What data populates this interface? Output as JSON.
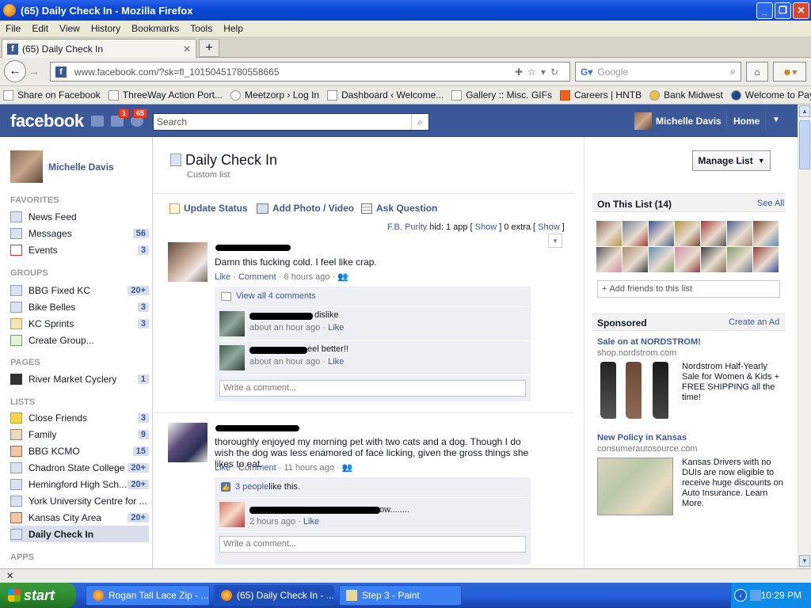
{
  "window": {
    "title": "(65) Daily Check In - Mozilla Firefox"
  },
  "menu": [
    "File",
    "Edit",
    "View",
    "History",
    "Bookmarks",
    "Tools",
    "Help"
  ],
  "tab": {
    "title": "(65) Daily Check In"
  },
  "url": "www.facebook.com/?sk=fl_10150451780558665",
  "browser_search_placeholder": "Google",
  "bookmarks": [
    "Share on Facebook",
    "ThreeWay Action Port...",
    "Meetzorp › Log In",
    "Dashboard ‹ Welcome...",
    "Gallery :: Misc. GIFs",
    "Careers | HNTB",
    "Bank Midwest",
    "Welcome to PayXpress!"
  ],
  "fb": {
    "logo": "facebook",
    "badge_messages": "1",
    "badge_notifications": "65",
    "search_placeholder": "Search",
    "user_name": "Michelle Davis",
    "home": "Home"
  },
  "left": {
    "profile_name": "Michelle Davis",
    "favorites_head": "FAVORITES",
    "favorites": [
      {
        "label": "News Feed",
        "count": ""
      },
      {
        "label": "Messages",
        "count": "56"
      },
      {
        "label": "Events",
        "count": "3"
      }
    ],
    "groups_head": "GROUPS",
    "groups": [
      {
        "label": "BBG Fixed KC",
        "count": "20+"
      },
      {
        "label": "Bike Belles",
        "count": "3"
      },
      {
        "label": "KC Sprints",
        "count": "3"
      },
      {
        "label": "Create Group...",
        "count": ""
      }
    ],
    "pages_head": "PAGES",
    "pages": [
      {
        "label": "River Market Cyclery",
        "count": "1"
      }
    ],
    "lists_head": "LISTS",
    "lists": [
      {
        "label": "Close Friends",
        "count": "3"
      },
      {
        "label": "Family",
        "count": "9"
      },
      {
        "label": "BBG KCMO",
        "count": "15"
      },
      {
        "label": "Chadron State College",
        "count": "20+"
      },
      {
        "label": "Hemingford High Sch...",
        "count": "20+"
      },
      {
        "label": "York University Centre for ...",
        "count": ""
      },
      {
        "label": "Kansas City Area",
        "count": "20+"
      },
      {
        "label": "Daily Check In",
        "count": ""
      }
    ],
    "apps_head": "APPS"
  },
  "main": {
    "title": "Daily Check In",
    "subtitle": "Custom list",
    "manage_list": "Manage List",
    "composer": [
      "Update Status",
      "Add Photo / Video",
      "Ask Question"
    ],
    "purity": {
      "prefix": "F.B. Purity",
      "hid": " hid:  1 app [ ",
      "show1": "Show",
      "mid": " ]  0 extra [ ",
      "show2": "Show",
      "end": " ]"
    },
    "post1": {
      "text": "Damn this fucking cold. I feel like crap.",
      "like": "Like",
      "comment": "Comment",
      "time": "6 hours ago",
      "view_all": "View all 4 comments",
      "comments": [
        {
          "text": "dislike",
          "time": "about an hour ago",
          "like": "Like"
        },
        {
          "text": "eel better!!",
          "time": "about an hour ago",
          "like": "Like"
        }
      ],
      "write": "Write a comment..."
    },
    "post2": {
      "text": "thoroughly enjoyed my morning pet with two cats and a dog. Though I do wish the dog was less enamored of face licking, given the gross things she likes to eat.",
      "like": "Like",
      "comment": "Comment",
      "time": "11 hours ago",
      "likes_count": "3 people",
      "likes_suffix": " like this.",
      "comment1": {
        "text": "ow........",
        "time": "2 hours ago",
        "like": "Like"
      },
      "write": "Write a comment..."
    }
  },
  "right": {
    "on_list": "On This List (14)",
    "see_all": "See All",
    "add_friends": "Add friends to this list",
    "sponsored": "Sponsored",
    "create_ad": "Create an Ad",
    "ad1": {
      "title": "Sale on at NORDSTROM!",
      "domain": "shop.nordstrom.com",
      "body": "Nordstrom Half-Yearly Sale for Women & Kids + FREE SHIPPING all the time!"
    },
    "ad2": {
      "title": "New Policy in Kansas",
      "domain": "consumerautosource.com",
      "body": "Kansas Drivers with no DUIs are now eligible to receive huge discounts on Auto Insurance. Learn More."
    }
  },
  "taskbar": {
    "start": "start",
    "tasks": [
      "Rogan Tall Lace Zip - ...",
      "(65) Daily Check In - ...",
      "Step 3 - Paint"
    ],
    "clock": "10:29 PM"
  }
}
